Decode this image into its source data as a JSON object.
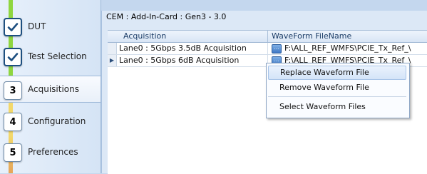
{
  "sidebar": {
    "steps": [
      {
        "badge": "✓",
        "label": "DUT",
        "state": "done"
      },
      {
        "badge": "✓",
        "label": "Test Selection",
        "state": "done"
      },
      {
        "badge": "3",
        "label": "Acquisitions",
        "state": "active"
      },
      {
        "badge": "4",
        "label": "Configuration",
        "state": "pending"
      },
      {
        "badge": "5",
        "label": "Preferences",
        "state": "pending"
      }
    ]
  },
  "main": {
    "title": "CEM : Add-In-Card : Gen3 - 3.0",
    "table": {
      "columns": [
        "Acquisition",
        "WaveForm FileName"
      ],
      "rows": [
        {
          "selector": "",
          "acquisition": "Lane0 : 5Gbps 3.5dB Acquisition",
          "filename": "F:\\ALL_REF_WMFS\\PCIE_Tx_Ref_\\"
        },
        {
          "selector": "▶",
          "acquisition": "Lane0 : 5Gbps 6dB Acquisition",
          "filename": "F:\\ALL_REF_WMFS\\PCIE_Tx_Ref_\\"
        }
      ]
    }
  },
  "context_menu": {
    "items": [
      "Replace Waveform File",
      "Remove Waveform File",
      "Select Waveform Files"
    ],
    "highlighted_index": 0
  },
  "colors": {
    "done_rail": "#8fd63f",
    "pending_rail": "#f3d86a",
    "header_text": "#1b3c66"
  },
  "icons": {
    "done": "checkmark-icon",
    "file_button": "browse-file-icon",
    "row_selector": "row-pointer-icon"
  }
}
